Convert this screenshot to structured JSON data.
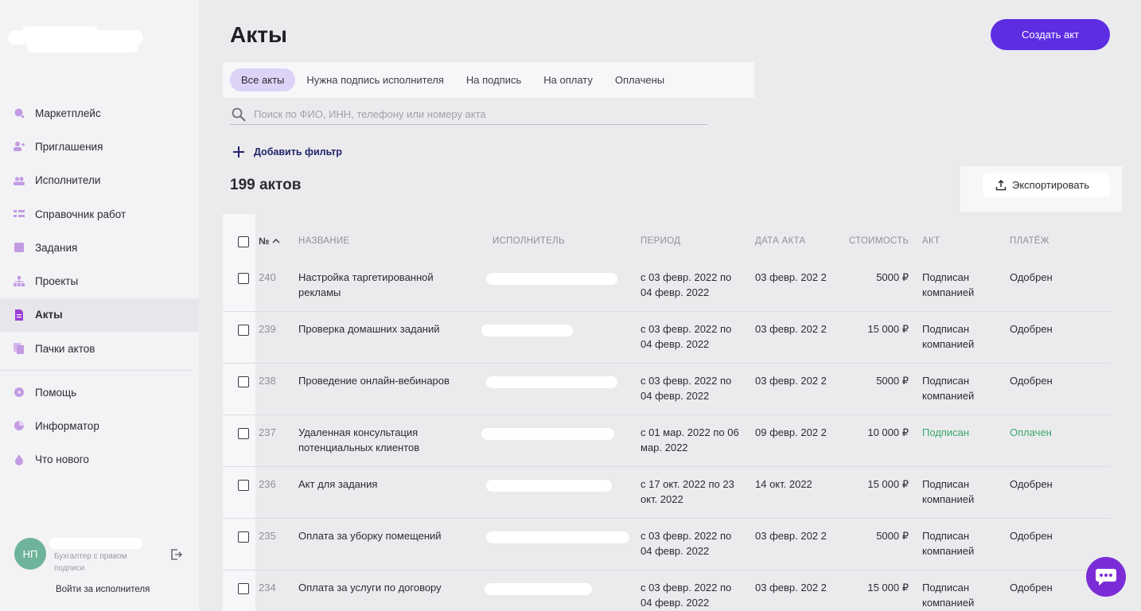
{
  "sidebar": {
    "items": [
      {
        "label": "Маркетплейс",
        "icon": "search-dot-icon"
      },
      {
        "label": "Приглашения",
        "icon": "user-plus-icon"
      },
      {
        "label": "Исполнители",
        "icon": "users-icon"
      },
      {
        "label": "Справочник работ",
        "icon": "list-icon"
      },
      {
        "label": "Задания",
        "icon": "square-icon"
      },
      {
        "label": "Проекты",
        "icon": "hierarchy-icon"
      },
      {
        "label": "Акты",
        "icon": "document-icon",
        "active": true
      },
      {
        "label": "Пачки актов",
        "icon": "documents-stack-icon"
      }
    ],
    "secondary": [
      {
        "label": "Помощь",
        "icon": "help-icon"
      },
      {
        "label": "Информатор",
        "icon": "pie-icon"
      },
      {
        "label": "Что нового",
        "icon": "drop-icon"
      }
    ],
    "user": {
      "initials": "НП",
      "role": "Бухгалтер с правом подписи",
      "switch_label": "Войти за исполнителя"
    }
  },
  "header": {
    "title": "Акты",
    "create_button": "Создать акт"
  },
  "tabs": [
    {
      "label": "Все акты",
      "active": true
    },
    {
      "label": "Нужна подпись исполнителя"
    },
    {
      "label": "На подпись"
    },
    {
      "label": "На оплату"
    },
    {
      "label": "Оплачены"
    }
  ],
  "search": {
    "placeholder": "Поиск по ФИО, ИНН, телефону или номеру акта",
    "value": ""
  },
  "filter": {
    "add_label": "Добавить фильтр"
  },
  "summary": {
    "count": "199 актов"
  },
  "export": {
    "label": "Экспортировать"
  },
  "table": {
    "columns": {
      "num": "№",
      "name": "НАЗВАНИЕ",
      "executor": "ИСПОЛНИТЕЛЬ",
      "period": "ПЕРИОД",
      "date": "ДАТА АКТА",
      "cost": "СТОИМОСТЬ",
      "act": "АКТ",
      "payment": "ПЛАТЁЖ"
    },
    "rows": [
      {
        "num": "240",
        "name": "Настройка таргетированной рекламы",
        "period": "с 03 февр. 2022 по 04 февр. 2022",
        "date": "03 февр. 202 2",
        "cost": "5000 ₽",
        "act": "Подписан компанией",
        "payment": "Одобрен"
      },
      {
        "num": "239",
        "name": "Проверка домашних заданий",
        "period": "с 03 февр. 2022 по 04 февр. 2022",
        "date": "03 февр. 202 2",
        "cost": "15 000 ₽",
        "act": "Подписан компанией",
        "payment": "Одобрен"
      },
      {
        "num": "238",
        "name": "Проведение онлайн-вебинаров",
        "period": "с 03 февр. 2022 по 04 февр. 2022",
        "date": "03 февр. 202 2",
        "cost": "5000 ₽",
        "act": "Подписан компанией",
        "payment": "Одобрен"
      },
      {
        "num": "237",
        "name": "Удаленная консультация потенциальных клиентов",
        "period": "с 01 мар. 2022 по 06 мар. 2022",
        "date": "09 февр. 202 2",
        "cost": "10 000 ₽",
        "act": "Подписан",
        "payment": "Оплачен"
      },
      {
        "num": "236",
        "name": "Акт для задания",
        "period": "с 17 окт. 2022 по 23 окт. 2022",
        "date": "14 окт. 2022",
        "cost": "15 000 ₽",
        "act": "Подписан компанией",
        "payment": "Одобрен"
      },
      {
        "num": "235",
        "name": "Оплата за уборку помещений",
        "period": "с 03 февр. 2022 по 04 февр. 2022",
        "date": "03 февр. 202 2",
        "cost": "5000 ₽",
        "act": "Подписан компанией",
        "payment": "Одобрен"
      },
      {
        "num": "234",
        "name": "Оплата за услуги по договору",
        "period": "с 03 февр. 2022 по 04 февр. 2022",
        "date": "03 февр. 202 2",
        "cost": "15 000 ₽",
        "act": "Подписан компанией",
        "payment": "Одобрен"
      }
    ]
  },
  "colors": {
    "accent": "#5d2de2",
    "active_tab": "#ddd3f7",
    "success": "#3aa86b",
    "sidebar_icon": "#b98fe0",
    "chat": "#7b2cd6"
  }
}
